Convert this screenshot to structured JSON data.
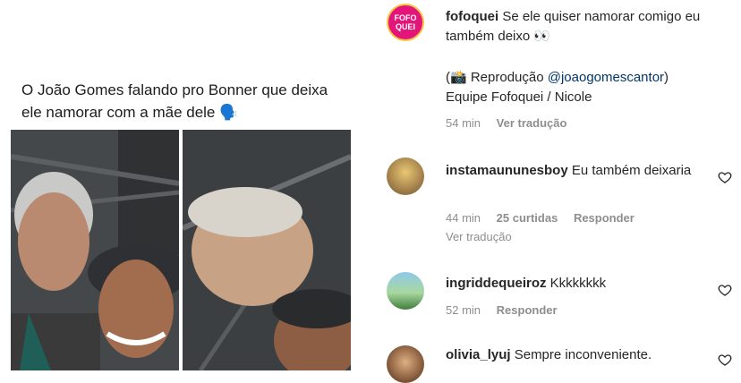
{
  "post": {
    "caption": "O João Gomes falando pro Bonner que deixa ele namorar com a mãe dele 🗣️"
  },
  "comments": [
    {
      "username": "fofoquei",
      "text": "Se ele quiser namorar comigo eu também deixo 👀",
      "extra_line_1": "(📸 Reprodução ",
      "extra_mention": "@joaogomescantor",
      "extra_line_1_end": ")",
      "extra_line_2": "Equipe Fofoquei / Nicole",
      "time": "54 min",
      "translate": "Ver tradução",
      "avatar_text": "FOFO QUEI",
      "avatar_color": "#e4157a"
    },
    {
      "username": "instamaununesboy",
      "text": "Eu também deixaria",
      "time": "44 min",
      "likes": "25 curtidas",
      "reply": "Responder",
      "translate": "Ver tradução"
    },
    {
      "username": "ingriddequeiroz",
      "text": "Kkkkkkkk",
      "time": "52 min",
      "reply": "Responder"
    },
    {
      "username": "olivia_lyuj",
      "text": "Sempre inconveniente."
    }
  ],
  "icons": {
    "like": "heart-outline-icon"
  }
}
